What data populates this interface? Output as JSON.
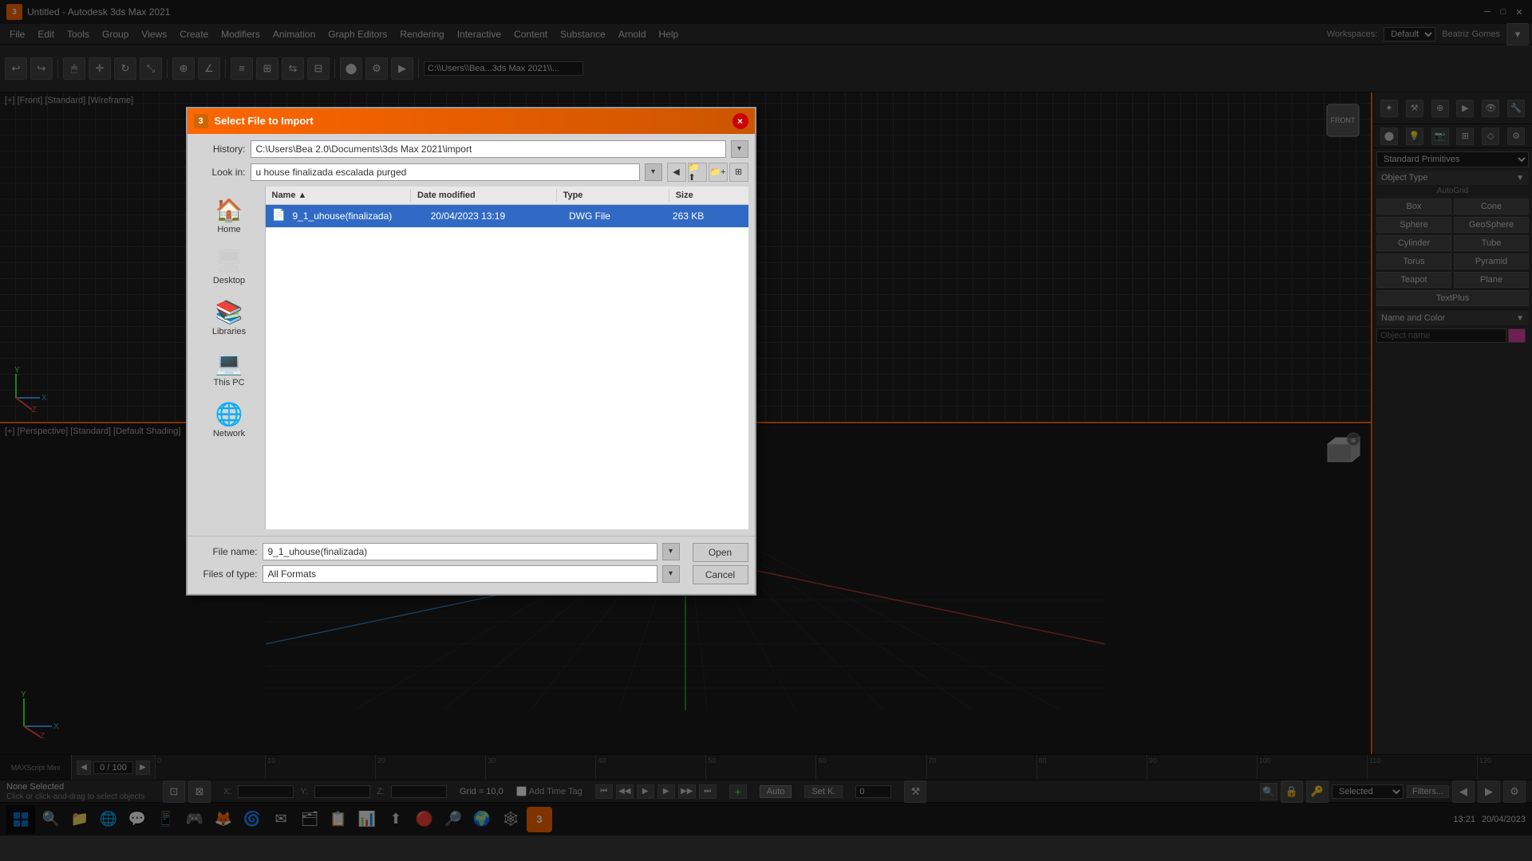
{
  "app": {
    "title": "Untitled - Autodesk 3ds Max 2021",
    "logo_text": "3"
  },
  "menu": {
    "items": [
      "File",
      "Edit",
      "Tools",
      "Group",
      "Views",
      "Create",
      "Modifiers",
      "Animation",
      "Graph Editors",
      "Rendering",
      "Interactive",
      "Content",
      "Substance",
      "Arnold",
      "Help"
    ]
  },
  "right_panel": {
    "dropdown_label": "Standard Primitives",
    "object_type_label": "Object Type",
    "autogrid_label": "AutoGrid",
    "buttons": [
      {
        "label": "Box"
      },
      {
        "label": "Cone"
      },
      {
        "label": "Sphere"
      },
      {
        "label": "GeoSphere"
      },
      {
        "label": "Cylinder"
      },
      {
        "label": "Tube"
      },
      {
        "label": "Torus"
      },
      {
        "label": "Pyramid"
      },
      {
        "label": "Teapot"
      },
      {
        "label": "Plane"
      },
      {
        "label": "TextPlus"
      }
    ],
    "name_color_label": "Name and Color",
    "color_hex": "#e040a0"
  },
  "viewport_front": {
    "label": "[+] [Front] [Standard] [Wireframe]"
  },
  "viewport_perspective": {
    "label": "[+] [Perspective] [Standard] [Default Shading]"
  },
  "dialog": {
    "title": "Select File to Import",
    "close_btn": "×",
    "history_label": "History:",
    "history_value": "C:\\Users\\Bea 2.0\\Documents\\3ds Max 2021\\import",
    "lookin_label": "Look in:",
    "lookin_value": "u house finalizada escalada purged",
    "columns": [
      "Name",
      "Date modified",
      "Type",
      "Size"
    ],
    "files": [
      {
        "icon": "📄",
        "name": "9_1_uhouse(finalizada)",
        "date": "20/04/2023 13:19",
        "type": "DWG File",
        "size": "263 KB",
        "selected": true
      }
    ],
    "shortcuts": [
      {
        "icon": "🏠",
        "label": "Home"
      },
      {
        "icon": "🖥",
        "label": "Desktop"
      },
      {
        "icon": "📚",
        "label": "Libraries"
      },
      {
        "icon": "💻",
        "label": "This PC"
      },
      {
        "icon": "🌐",
        "label": "Network"
      }
    ],
    "filename_label": "File name:",
    "filename_value": "9_1_uhouse(finalizada)",
    "filetype_label": "Files of type:",
    "filetype_value": "All Formats",
    "open_btn": "Open",
    "cancel_btn": "Cancel"
  },
  "status_bar": {
    "none_selected": "None Selected",
    "click_hint": "Click or click-and-drag to select objects",
    "x_label": "X:",
    "x_value": "",
    "y_label": "Y:",
    "y_value": "",
    "z_label": "Z:",
    "z_value": "",
    "grid": "Grid = 10,0",
    "add_time": "Add Time Tag",
    "auto": "Auto",
    "selected": "Selected",
    "filters": "Filters...",
    "set_key": "Set K.",
    "counter": "0 / 100"
  },
  "taskbar": {
    "time": "13:21",
    "date": "20/04/2023",
    "workspaces": "Workspaces:",
    "workspace_value": "Default",
    "user": "Beatriz Gomes"
  }
}
